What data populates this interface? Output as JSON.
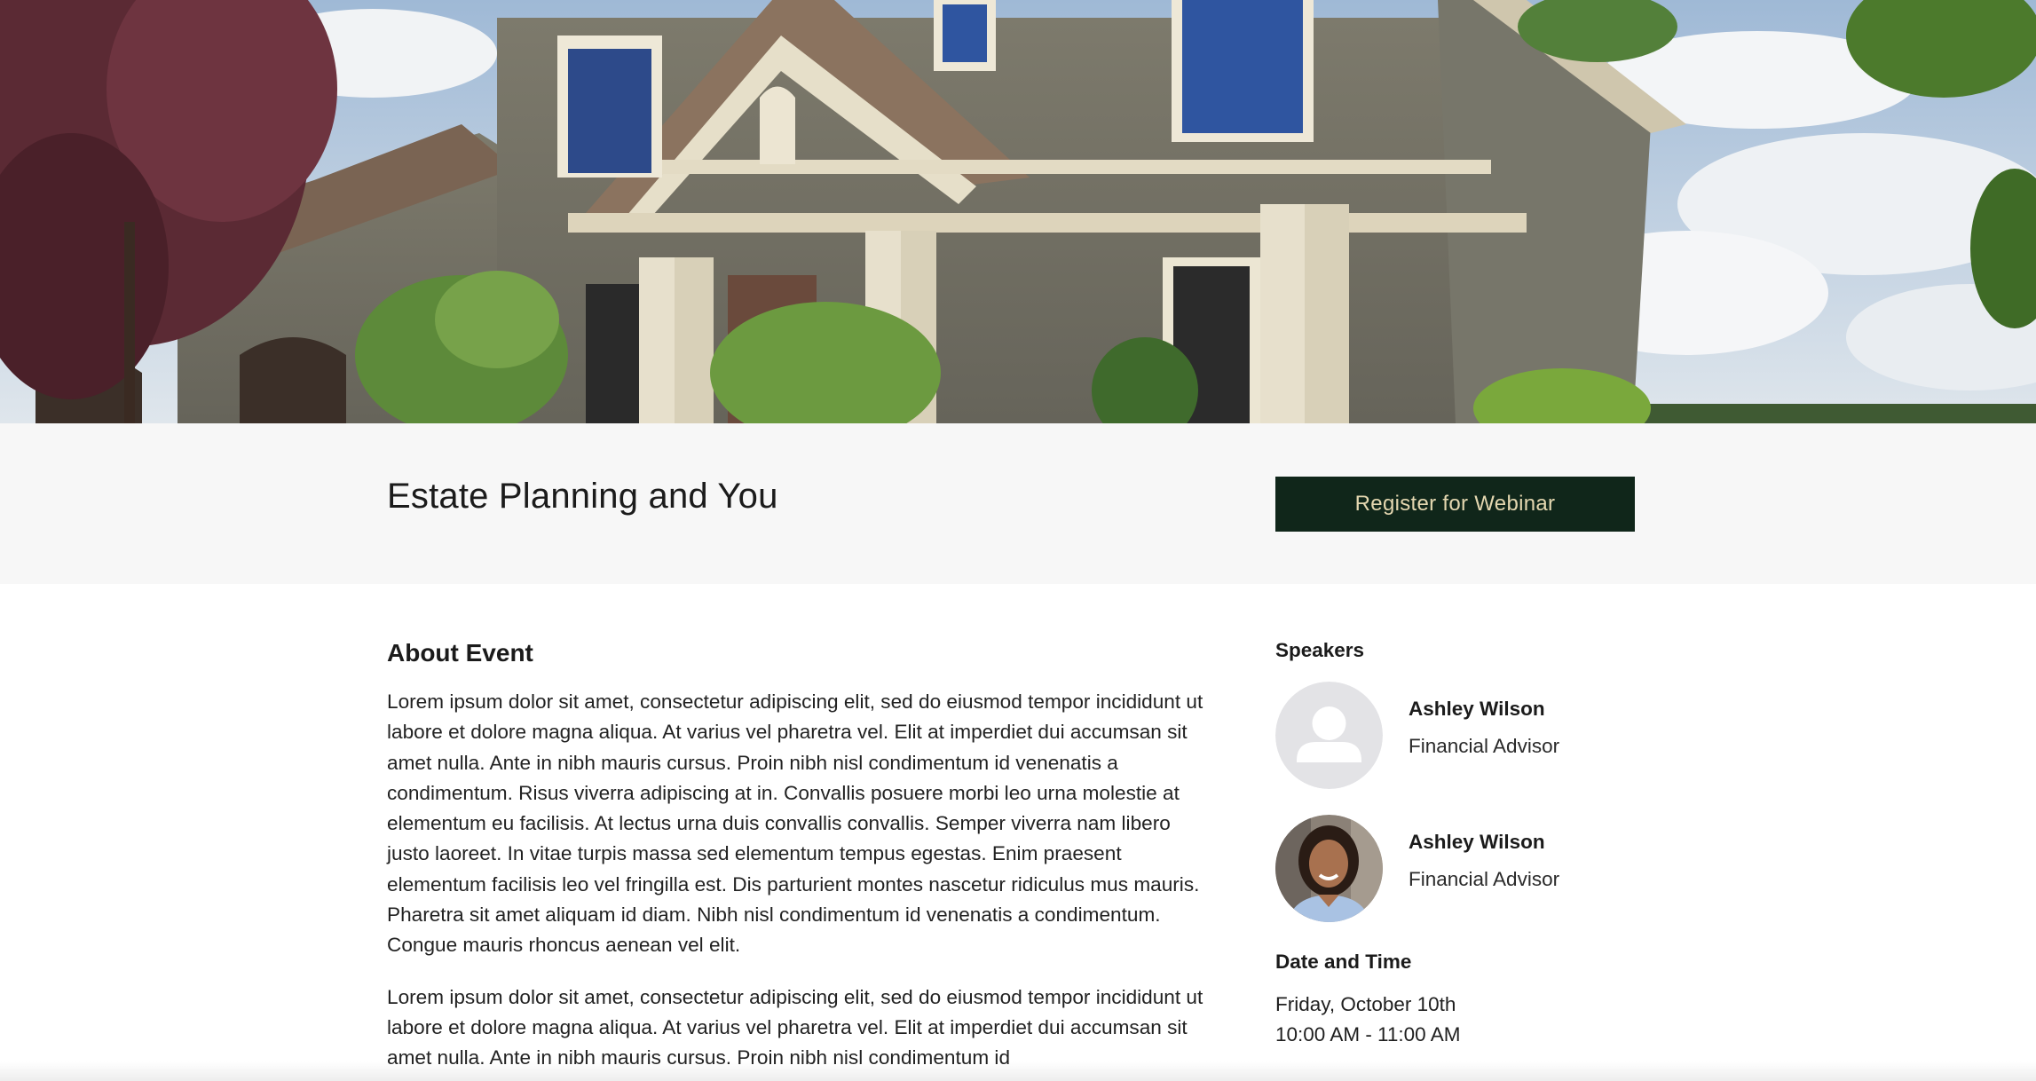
{
  "hero": {
    "image_label": "house-photo"
  },
  "header": {
    "title": "Estate Planning and You",
    "register_label": "Register for Webinar"
  },
  "about": {
    "heading": "About Event",
    "paragraphs": [
      "Lorem ipsum dolor sit amet, consectetur adipiscing elit, sed do eiusmod tempor incididunt ut labore et dolore magna aliqua. At varius vel pharetra vel. Elit at imperdiet dui accumsan sit amet nulla. Ante in nibh mauris cursus. Proin nibh nisl condimentum id venenatis a condimentum. Risus viverra adipiscing at in. Convallis posuere morbi leo urna molestie at elementum eu facilisis. At lectus urna duis convallis convallis. Semper viverra nam libero justo laoreet. In vitae turpis massa sed elementum tempus egestas. Enim praesent elementum facilisis leo vel fringilla est. Dis parturient montes nascetur ridiculus mus mauris. Pharetra sit amet aliquam id diam. Nibh nisl condimentum id venenatis a condimentum. Congue mauris rhoncus aenean vel elit.",
      "Lorem ipsum dolor sit amet, consectetur adipiscing elit, sed do eiusmod tempor incididunt ut labore et dolore magna aliqua. At varius vel pharetra vel. Elit at imperdiet dui accumsan sit amet nulla. Ante in nibh mauris cursus. Proin nibh nisl condimentum id"
    ]
  },
  "sidebar": {
    "speakers_heading": "Speakers",
    "speakers": [
      {
        "name": "Ashley Wilson",
        "role": "Financial Advisor",
        "avatar": "placeholder-person-icon"
      },
      {
        "name": "Ashley Wilson",
        "role": "Financial Advisor",
        "avatar": "speaker-photo"
      }
    ],
    "datetime_heading": "Date and Time",
    "date": "Friday, October 10th",
    "time": "10:00 AM - 11:00 AM"
  },
  "colors": {
    "button_bg": "#10261a",
    "button_text": "#e4d7b0",
    "band_bg": "#f7f7f7"
  }
}
